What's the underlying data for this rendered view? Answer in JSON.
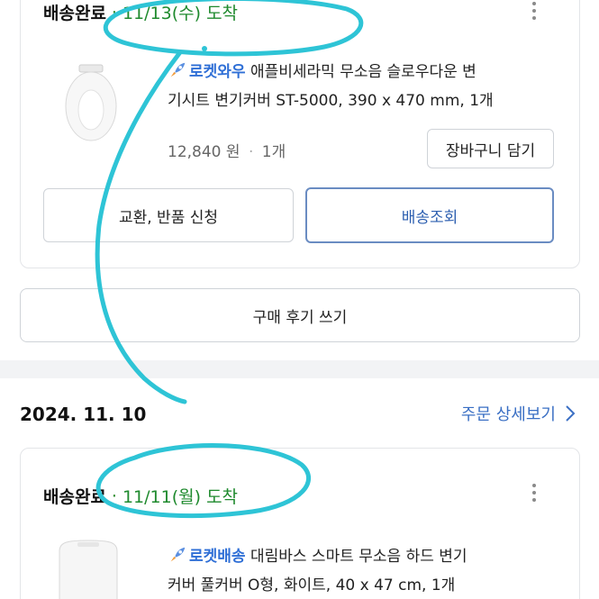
{
  "order1": {
    "status": "배송완료",
    "arrival": "11/13(수) 도착",
    "badge": "로켓와우",
    "product_line1": "애플비세라믹 무소음 슬로우다운 변",
    "product_line2": "기시트 변기커버 ST-5000, 390 x 470 mm, 1개",
    "price": "12,840 원",
    "qty": "1개",
    "cart_button": "장바구니 담기",
    "exchange_button": "교환, 반품 신청",
    "tracking_button": "배송조회",
    "review_button": "구매 후기 쓰기"
  },
  "order2": {
    "date": "2024. 11. 10",
    "detail_link": "주문 상세보기",
    "status": "배송완료",
    "arrival": "11/11(월) 도착",
    "badge": "로켓배송",
    "product_line1": "대림바스 스마트 무소음 하드 변기",
    "product_line2": "커버 풀커버 O형, 화이트, 40 x 47 cm, 1개"
  },
  "colors": {
    "annotation": "#2ec4d6",
    "arrival_green": "#1f8a2e",
    "link_blue": "#3a6fc4",
    "badge_blue": "#2f6fd6"
  },
  "icons": [
    "kebab-menu-icon",
    "rocket-icon",
    "chevron-right-icon"
  ]
}
